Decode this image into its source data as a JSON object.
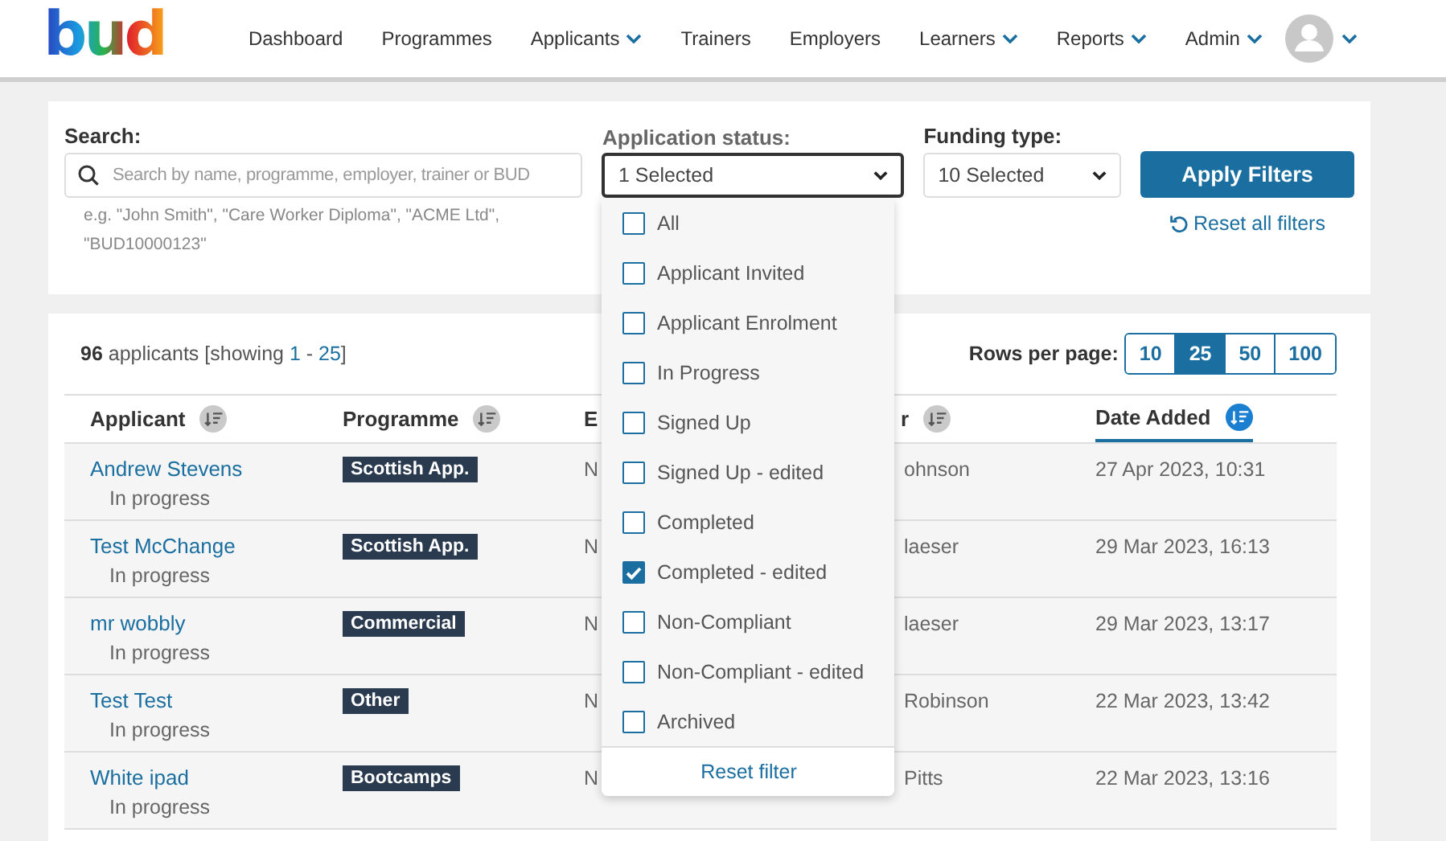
{
  "logo": {
    "text": "bud"
  },
  "nav": [
    {
      "label": "Dashboard",
      "has_menu": false
    },
    {
      "label": "Programmes",
      "has_menu": false
    },
    {
      "label": "Applicants",
      "has_menu": true
    },
    {
      "label": "Trainers",
      "has_menu": false
    },
    {
      "label": "Employers",
      "has_menu": false
    },
    {
      "label": "Learners",
      "has_menu": true
    },
    {
      "label": "Reports",
      "has_menu": true
    },
    {
      "label": "Admin",
      "has_menu": true
    }
  ],
  "filters": {
    "search": {
      "label": "Search:",
      "placeholder": "Search by name, programme, employer, trainer or BUD",
      "hint": "e.g. \"John Smith\", \"Care Worker Diploma\", \"ACME Ltd\", \"BUD10000123\""
    },
    "status": {
      "label": "Application status:",
      "value": "1 Selected",
      "expanded": true,
      "options": [
        {
          "label": "All",
          "checked": false
        },
        {
          "label": "Applicant Invited",
          "checked": false
        },
        {
          "label": "Applicant Enrolment",
          "checked": false
        },
        {
          "label": "In Progress",
          "checked": false
        },
        {
          "label": "Signed Up",
          "checked": false
        },
        {
          "label": "Signed Up - edited",
          "checked": false
        },
        {
          "label": "Completed",
          "checked": false
        },
        {
          "label": "Completed - edited",
          "checked": true
        },
        {
          "label": "Non-Compliant",
          "checked": false
        },
        {
          "label": "Non-Compliant - edited",
          "checked": false
        },
        {
          "label": "Archived",
          "checked": false
        }
      ],
      "reset": "Reset filter"
    },
    "funding": {
      "label": "Funding type:",
      "value": "10 Selected"
    },
    "apply": "Apply Filters",
    "reset_all": "Reset all filters"
  },
  "summary": {
    "count": "96",
    "text1": " applicants [showing ",
    "from": "1",
    "sep": " - ",
    "to": "25",
    "text2": "]"
  },
  "rows_per_page": {
    "label": "Rows per page:",
    "options": [
      {
        "label": "10",
        "selected": false
      },
      {
        "label": "25",
        "selected": true
      },
      {
        "label": "50",
        "selected": false
      },
      {
        "label": "100",
        "selected": false
      }
    ]
  },
  "table": {
    "columns": [
      {
        "label": "Applicant",
        "sortable": true,
        "sorted": false
      },
      {
        "label": "Programme",
        "sortable": true,
        "sorted": false
      },
      {
        "label": "E",
        "sortable": false,
        "sorted": false
      },
      {
        "label": "r",
        "sortable": true,
        "sorted": false
      },
      {
        "label": "Date Added",
        "sortable": true,
        "sorted": true
      }
    ],
    "rows": [
      {
        "name": "Andrew Stevens",
        "status": "In progress",
        "programme": "Scottish App.",
        "column_3": "N",
        "column_4": "ohnson",
        "date": "27 Apr 2023, 10:31"
      },
      {
        "name": "Test McChange",
        "status": "In progress",
        "programme": "Scottish App.",
        "column_3": "N",
        "column_4": "laeser",
        "date": "29 Mar 2023, 16:13"
      },
      {
        "name": "mr wobbly",
        "status": "In progress",
        "programme": "Commercial",
        "column_3": "N",
        "column_4": "laeser",
        "date": "29 Mar 2023, 13:17"
      },
      {
        "name": "Test Test",
        "status": "In progress",
        "programme": "Other",
        "column_3": "N",
        "column_4": "Robinson",
        "date": "22 Mar 2023, 13:42"
      },
      {
        "name": "White ipad",
        "status": "In progress",
        "programme": "Bootcamps",
        "column_3": "N",
        "column_4": "Pitts",
        "date": "22 Mar 2023, 13:16"
      }
    ]
  }
}
